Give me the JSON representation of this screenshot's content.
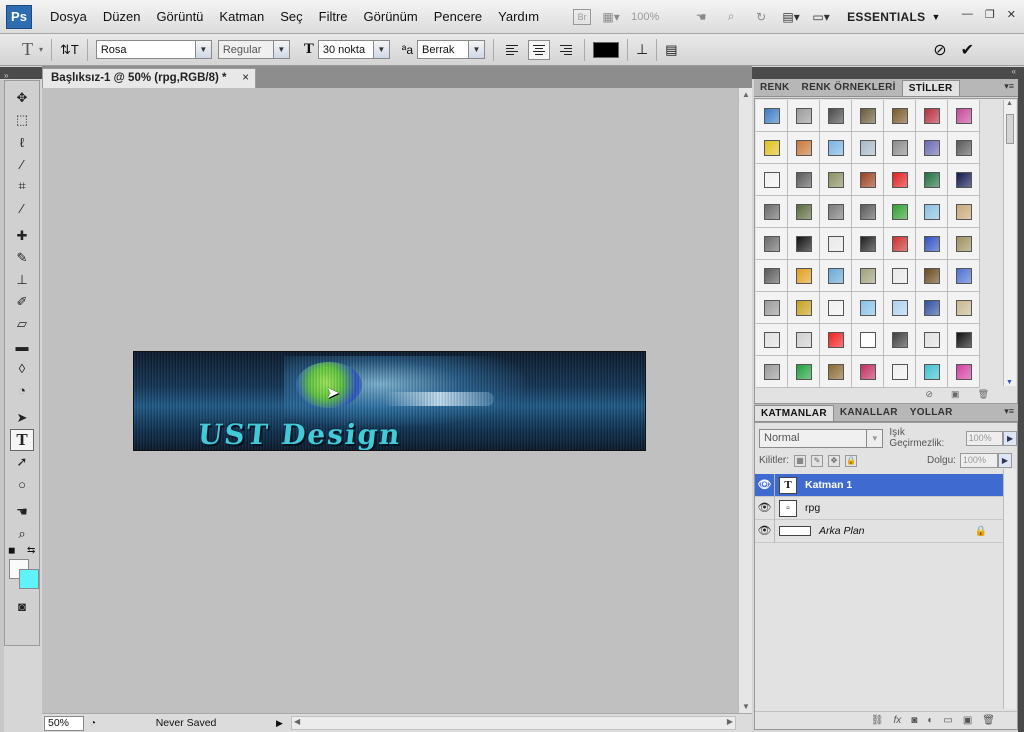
{
  "app": {
    "logo": "Ps",
    "menu": [
      "Dosya",
      "Düzen",
      "Görüntü",
      "Katman",
      "Seç",
      "Filtre",
      "Görünüm",
      "Pencere",
      "Yardım"
    ],
    "bridge_icon": "Br",
    "zoom_readout": "100%",
    "workspace": "ESSENTIALS",
    "window_controls": [
      "—",
      "❐",
      "✕"
    ]
  },
  "options": {
    "font_family": "Rosa",
    "font_style": "Regular",
    "font_size": "30 nokta",
    "antialias": "Berrak",
    "text_color": "#000000"
  },
  "document": {
    "tab_title": "Başlıksız-1 @ 50% (rpg,RGB/8) *",
    "tab_close": "×",
    "banner_text": "UST Design",
    "zoom": "50%",
    "status": "Never Saved"
  },
  "tools": [
    {
      "name": "move-tool-icon",
      "glyph": "✥"
    },
    {
      "name": "marquee-tool-icon",
      "glyph": "⬚"
    },
    {
      "name": "lasso-tool-icon",
      "glyph": "ℓ"
    },
    {
      "name": "quick-selection-tool-icon",
      "glyph": "⁄"
    },
    {
      "name": "crop-tool-icon",
      "glyph": "⌗"
    },
    {
      "name": "eyedropper-tool-icon",
      "glyph": "⁄"
    },
    {
      "name": "spot-healing-tool-icon",
      "glyph": "✚"
    },
    {
      "name": "brush-tool-icon",
      "glyph": "✎"
    },
    {
      "name": "clone-stamp-tool-icon",
      "glyph": "⊥"
    },
    {
      "name": "history-brush-tool-icon",
      "glyph": "✐"
    },
    {
      "name": "eraser-tool-icon",
      "glyph": "▱"
    },
    {
      "name": "gradient-tool-icon",
      "glyph": "▬"
    },
    {
      "name": "blur-tool-icon",
      "glyph": "◊"
    },
    {
      "name": "dodge-tool-icon",
      "glyph": "◔"
    },
    {
      "name": "path-selection-tool-icon",
      "glyph": "➤"
    },
    {
      "name": "type-tool-icon",
      "glyph": "T"
    },
    {
      "name": "direct-selection-tool-icon",
      "glyph": "➚"
    },
    {
      "name": "ellipse-tool-icon",
      "glyph": "○"
    },
    {
      "name": "hand-tool-icon",
      "glyph": "☚"
    },
    {
      "name": "zoom-tool-icon",
      "glyph": "⌕"
    }
  ],
  "colors": {
    "foreground": "#fafafa",
    "background": "#5ef3f8",
    "selection": "#3f6bd1"
  },
  "styles_panel": {
    "tabs": [
      "RENK",
      "RENK ÖRNEKLERİ",
      "STİLLER"
    ],
    "active_tab": "STİLLER",
    "swatches": [
      "#3c7cc4",
      "#9a9a9a",
      "#4a4a4a",
      "#6b5a3c",
      "#7a5a2a",
      "#b43040",
      "#c44a9a",
      "#e0c020",
      "#c87838",
      "#7ab4e4",
      "#a8b8c8",
      "#8a8a8a",
      "#6a6ab0",
      "#5a5a5a",
      "#f0f0f0",
      "#5a5a5a",
      "#8a9060",
      "#9a4020",
      "#e02020",
      "#207040",
      "#101850",
      "#6a6a6a",
      "#5a6a40",
      "#7a7a7a",
      "#5a5a5a",
      "#30a030",
      "#8ac0e0",
      "#c8a878",
      "#6a6a6a",
      "#101010",
      "#e8e8e8",
      "#202020",
      "#c83030",
      "#3050c0",
      "#a09060",
      "#5a5a5a",
      "#e0a020",
      "#6aa8d8",
      "#a0a080",
      "#e8e8e8",
      "#6a4a20",
      "#5070d0",
      "#9a9a9a",
      "#c8a020",
      "#f0f0f0",
      "#88c0e8",
      "#b0d0f0",
      "#3050a0",
      "#c8b890",
      "#e0e0e0",
      "#cfcfcf",
      "#f02020",
      "#ffffff",
      "#404040",
      "#e0e0e0",
      "#101010",
      "#9a9a9a",
      "#20a040",
      "#8a6a30",
      "#c03060",
      "#f0f0f0",
      "#40c0d0",
      "#d040a0"
    ]
  },
  "layers_panel": {
    "tabs": [
      "KATMANLAR",
      "KANALLAR",
      "YOLLAR"
    ],
    "active_tab": "KATMANLAR",
    "blend_mode": "Normal",
    "opacity_label": "Işık Geçirmezlik:",
    "opacity_value": "100%",
    "lock_label": "Kilitler:",
    "fill_label": "Dolgu:",
    "fill_value": "100%",
    "layers": [
      {
        "name": "Katman 1",
        "thumb": "T",
        "selected": true
      },
      {
        "name": "rpg",
        "thumb": "▫",
        "selected": false
      },
      {
        "name": "Arka Plan",
        "thumb": "",
        "selected": false,
        "locked": true
      }
    ]
  }
}
